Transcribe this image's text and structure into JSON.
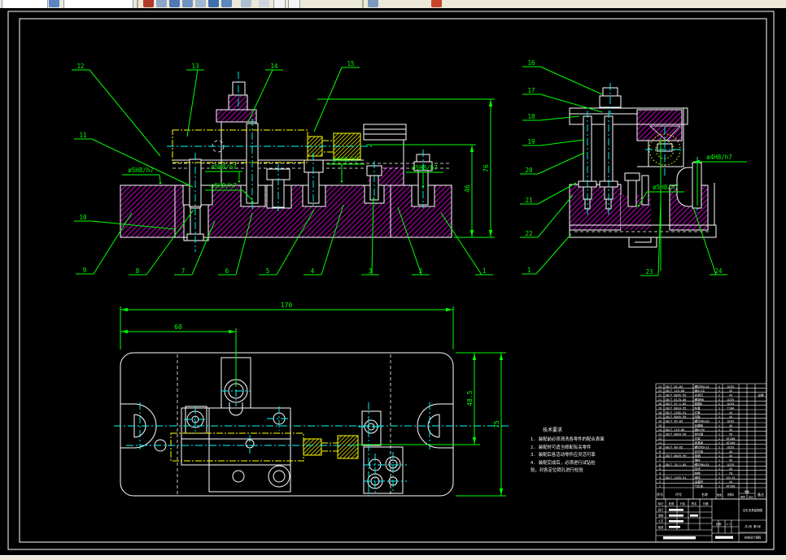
{
  "toolbar": {
    "icons": [
      "style-combo",
      "layer-list-icon",
      "layer-combo",
      "color-icon",
      "match-properties-icon",
      "undo-icon",
      "redo-icon",
      "pan-icon",
      "zoom-realtime-icon",
      "zoom-window-icon",
      "zoom-previous-icon",
      "sheet-icon",
      "sheet2-icon",
      "help-icon",
      "render-icon"
    ]
  },
  "callouts": [
    "1",
    "2",
    "3",
    "4",
    "5",
    "6",
    "7",
    "8",
    "9",
    "10",
    "11",
    "12",
    "13",
    "14",
    "15",
    "16",
    "17",
    "18",
    "19",
    "20",
    "21",
    "22",
    "23",
    "24"
  ],
  "dimensions": {
    "d170": "170",
    "d60": "60",
    "d485": "48.5",
    "d75": "75",
    "d76": "76",
    "d46": "46"
  },
  "fits": {
    "f5": "ø5H8/h7",
    "f4": "ø4H8/h7"
  },
  "notes": {
    "title": "技术要求",
    "lines": [
      "1. 装配前必须清洗各零件的配合表面",
      "2. 装配时可适当修配有关零件",
      "3. 装配后各活动零件应灵活可靠",
      "4. 装配完成后，必须进行试钻检",
      "验，对各定位销孔进行检验"
    ]
  },
  "bom": {
    "headers": {
      "no": "序号",
      "code": "代号",
      "name": "名称",
      "qty": "数量",
      "mat": "材料",
      "weight": "重量",
      "unit": "单件",
      "total": "总计",
      "rem": "备注"
    },
    "rows": [
      {
        "no": "24",
        "code": "GB/T 65-85",
        "name": "螺钉M5×16",
        "qty": "4",
        "mat": "Q235",
        "rem": ""
      },
      {
        "no": "23",
        "code": "GB/T 119-86",
        "name": "销5×18",
        "qty": "2",
        "mat": "35",
        "rem": ""
      },
      {
        "no": "22",
        "code": "JB/T 8045-95",
        "name": "支承钉",
        "qty": "2",
        "mat": "45",
        "rem": "淬硬"
      },
      {
        "no": "21",
        "code": "GB/T 6170-86",
        "name": "螺母M8",
        "qty": "2",
        "mat": "Q235",
        "rem": ""
      },
      {
        "no": "20",
        "code": "GB/T 97.1-85",
        "name": "垫圈8",
        "qty": "2",
        "mat": "Q235",
        "rem": ""
      },
      {
        "no": "19",
        "code": "JB/T 8010-95",
        "name": "钻套",
        "qty": "1",
        "mat": "T10A",
        "rem": ""
      },
      {
        "no": "18",
        "code": "GB/T 2205-91",
        "name": "衬套",
        "qty": "1",
        "mat": "45",
        "rem": ""
      },
      {
        "no": "17",
        "code": "JB/T 8045-99",
        "name": "压板",
        "qty": "1",
        "mat": "45",
        "rem": ""
      },
      {
        "no": "16",
        "code": "GB/T 65-85",
        "name": "螺钉M6×20",
        "qty": "2",
        "mat": "Q235",
        "rem": ""
      },
      {
        "no": "15",
        "code": "",
        "name": "钻模板",
        "qty": "1",
        "mat": "45",
        "rem": ""
      },
      {
        "no": "14",
        "code": "GB/T 119-86",
        "name": "销6×30",
        "qty": "2",
        "mat": "35",
        "rem": ""
      },
      {
        "no": "13",
        "code": "JB/T 8044-99",
        "name": "定位销",
        "qty": "1",
        "mat": "T8",
        "rem": ""
      },
      {
        "no": "12",
        "code": "",
        "name": "支架",
        "qty": "1",
        "mat": "HT200",
        "rem": ""
      },
      {
        "no": "11",
        "code": "",
        "name": "夹具体",
        "qty": "1",
        "mat": "HT200",
        "rem": ""
      },
      {
        "no": "10",
        "code": "GB/T 68-85",
        "name": "螺钉M5×12",
        "qty": "2",
        "mat": "Q235",
        "rem": ""
      },
      {
        "no": "9",
        "code": "",
        "name": "定位板",
        "qty": "1",
        "mat": "45",
        "rem": ""
      },
      {
        "no": "8",
        "code": "JB/T 8029-99",
        "name": "挡销",
        "qty": "1",
        "mat": "45",
        "rem": ""
      },
      {
        "no": "7",
        "code": "",
        "name": "滑柱",
        "qty": "1",
        "mat": "45",
        "rem": ""
      },
      {
        "no": "6",
        "code": "GB/T 70.1-85",
        "name": "螺钉M6×25",
        "qty": "4",
        "mat": "Q235",
        "rem": ""
      },
      {
        "no": "5",
        "code": "",
        "name": "压块",
        "qty": "1",
        "mat": "45",
        "rem": ""
      },
      {
        "no": "4",
        "code": "",
        "name": "斜楔",
        "qty": "1",
        "mat": "T8",
        "rem": ""
      },
      {
        "no": "3",
        "code": "GB/T 2203-91",
        "name": "钢球",
        "qty": "1",
        "mat": "GCr15",
        "rem": ""
      },
      {
        "no": "2",
        "code": "",
        "name": "活塞杆",
        "qty": "1",
        "mat": "45",
        "rem": ""
      },
      {
        "no": "1",
        "code": "",
        "name": "气缸体",
        "qty": "1",
        "mat": "HT200",
        "rem": ""
      }
    ]
  },
  "titleblock": {
    "labels": {
      "mark": "标记",
      "count": "处数",
      "zone": "分区",
      "sign": "签名",
      "date": "日期",
      "design": "设计",
      "check": "审核",
      "process": "工艺",
      "approve": "批准",
      "scale": "比例",
      "scale_val": "1:1",
      "title": "钻孔夹具装配图",
      "sheet": "共1张 第1张",
      "org": "机械设计课程"
    }
  }
}
